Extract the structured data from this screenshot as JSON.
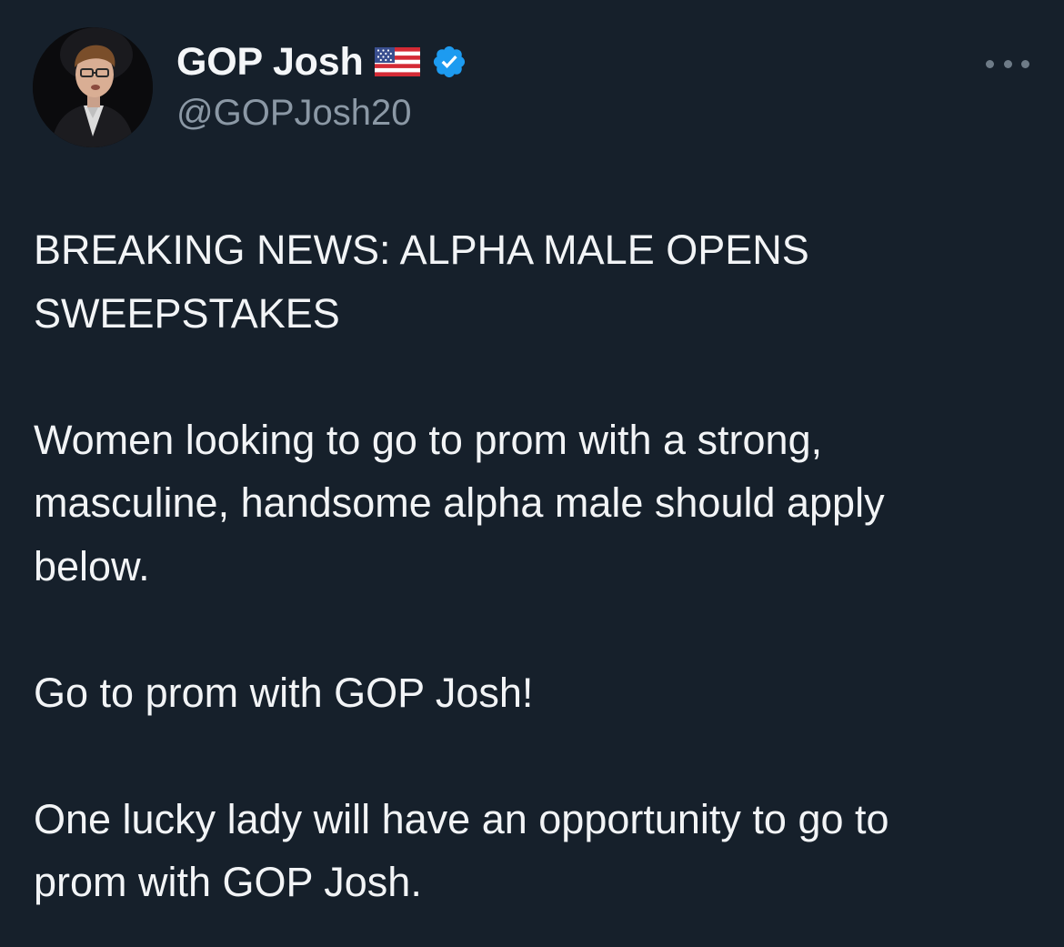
{
  "user": {
    "display_name": "GOP Josh",
    "handle": "@GOPJosh20",
    "flag_icon": "us-flag-icon",
    "verified_icon": "verified-badge-icon",
    "verified_color": "#1d9bf0"
  },
  "menu": {
    "icon": "more-options-icon"
  },
  "tweet": {
    "line_1": "BREAKING NEWS: ALPHA MALE OPENS",
    "line_2": "SWEEPSTAKES",
    "line_3": "Women looking to go to prom with a strong,",
    "line_4": "masculine, handsome alpha male should apply",
    "line_5": "below.",
    "line_6": "Go to prom with GOP Josh!",
    "line_7": "One lucky lady will have an opportunity to go to",
    "line_8": "prom with GOP Josh."
  },
  "colors": {
    "background": "#16202b",
    "text": "#f2f4f6",
    "secondary_text": "#8b98a5"
  }
}
